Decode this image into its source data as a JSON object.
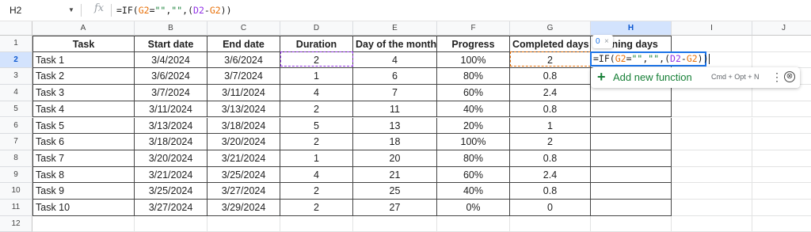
{
  "name_box": "H2",
  "formula_parts": [
    {
      "t": "=IF(",
      "c": "b"
    },
    {
      "t": "G2",
      "c": "g"
    },
    {
      "t": "=",
      "c": "b"
    },
    {
      "t": "\"\"",
      "c": "s"
    },
    {
      "t": ",",
      "c": "b"
    },
    {
      "t": "\"\"",
      "c": "s"
    },
    {
      "t": ",(",
      "c": "b"
    },
    {
      "t": "D2",
      "c": "d"
    },
    {
      "t": "-",
      "c": "b"
    },
    {
      "t": "G2",
      "c": "g"
    },
    {
      "t": "))",
      "c": "b"
    }
  ],
  "columns": [
    "A",
    "B",
    "C",
    "D",
    "E",
    "F",
    "G",
    "H",
    "I",
    "J"
  ],
  "selected_column": "H",
  "selected_row": "2",
  "row_numbers": [
    "1",
    "2",
    "3",
    "4",
    "5",
    "6",
    "7",
    "8",
    "9",
    "10",
    "11",
    "12"
  ],
  "headers": [
    "Task",
    "Start date",
    "End date",
    "Duration",
    "Day of the month",
    "Progress",
    "Completed days",
    "aining days"
  ],
  "rows": [
    [
      "Task 1",
      "3/4/2024",
      "3/6/2024",
      "2",
      "4",
      "100%",
      "2",
      ""
    ],
    [
      "Task 2",
      "3/6/2024",
      "3/7/2024",
      "1",
      "6",
      "80%",
      "0.8",
      ""
    ],
    [
      "Task 3",
      "3/7/2024",
      "3/11/2024",
      "4",
      "7",
      "60%",
      "2.4",
      ""
    ],
    [
      "Task 4",
      "3/11/2024",
      "3/13/2024",
      "2",
      "11",
      "40%",
      "0.8",
      ""
    ],
    [
      "Task 5",
      "3/13/2024",
      "3/18/2024",
      "5",
      "13",
      "20%",
      "1",
      ""
    ],
    [
      "Task 6",
      "3/18/2024",
      "3/20/2024",
      "2",
      "18",
      "100%",
      "2",
      ""
    ],
    [
      "Task 7",
      "3/20/2024",
      "3/21/2024",
      "1",
      "20",
      "80%",
      "0.8",
      ""
    ],
    [
      "Task 8",
      "3/21/2024",
      "3/25/2024",
      "4",
      "21",
      "60%",
      "2.4",
      ""
    ],
    [
      "Task 9",
      "3/25/2024",
      "3/27/2024",
      "2",
      "25",
      "40%",
      "0.8",
      ""
    ],
    [
      "Task 10",
      "3/27/2024",
      "3/29/2024",
      "2",
      "27",
      "0%",
      "0",
      ""
    ]
  ],
  "hint_chip": {
    "value": "0",
    "close": "×"
  },
  "popup": {
    "plus": "+",
    "label": "Add new function",
    "shortcut": "Cmd + Opt + N",
    "more": "⋮",
    "cancel": "⊗"
  },
  "icons": {
    "fx": "fx",
    "dropdown": "▼"
  },
  "colors": {
    "accent": "#1a73e8",
    "ref_g": "#e8710a",
    "ref_d": "#9334e6",
    "string": "#188038",
    "green": "#188038"
  }
}
